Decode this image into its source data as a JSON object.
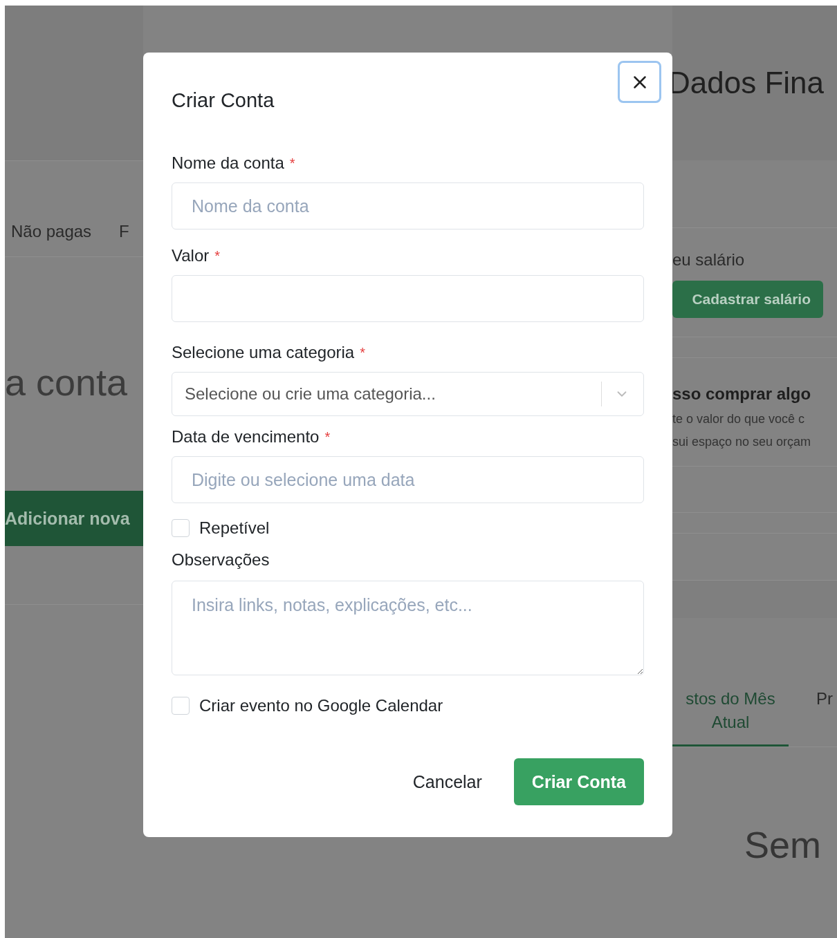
{
  "background": {
    "left": {
      "tabs": [
        {
          "label": "Não pagas"
        },
        {
          "label": "F"
        }
      ],
      "heading": "a conta",
      "add_button": "Adicionar nova"
    },
    "right": {
      "title": "Dados Fina",
      "salary_label": "eu salário",
      "salary_button": "Cadastrar salário",
      "question_title": "sso comprar algo",
      "question_lines": [
        "te o valor do que você c",
        "sui espaço no seu orçam"
      ],
      "tabs": [
        {
          "label": "stos do Mês Atual",
          "selected": true
        },
        {
          "label": "Pr",
          "selected": false
        }
      ],
      "empty_text": "Sem"
    }
  },
  "modal": {
    "title": "Criar Conta",
    "fields": [
      {
        "kind": "text",
        "label": "Nome da conta",
        "required_mark": "*",
        "placeholder": "Nome da conta"
      },
      {
        "kind": "text",
        "label": "Valor",
        "required_mark": "*"
      },
      {
        "kind": "select",
        "label": "Selecione uma categoria",
        "required_mark": "*",
        "placeholder": "Selecione ou crie uma categoria..."
      },
      {
        "kind": "text",
        "label": "Data de vencimento",
        "required_mark": "*",
        "placeholder": "Digite ou selecione uma data"
      },
      {
        "kind": "checkbox",
        "label": "Repetível",
        "checked": false
      },
      {
        "kind": "textarea",
        "label": "Observações",
        "placeholder": "Insira links, notas, explicações, etc..."
      },
      {
        "kind": "checkbox",
        "label": "Criar evento no Google Calendar",
        "checked": false
      }
    ],
    "buttons": [
      {
        "kind": "secondary",
        "label": "Cancelar"
      },
      {
        "kind": "primary",
        "label": "Criar Conta"
      }
    ]
  }
}
